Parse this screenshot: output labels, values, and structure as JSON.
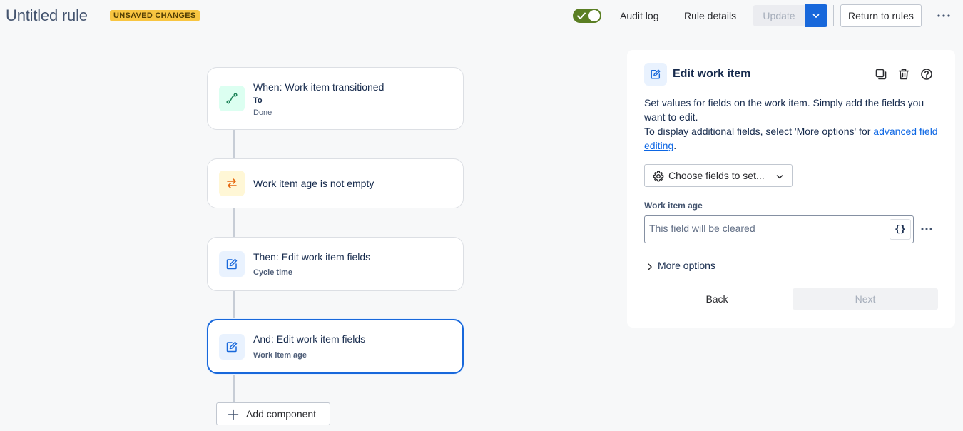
{
  "header": {
    "title": "Untitled rule",
    "badge": "UNSAVED CHANGES",
    "audit_log": "Audit log",
    "rule_details": "Rule details",
    "update": "Update",
    "return_to_rules": "Return to rules",
    "rule_enabled": true
  },
  "flow": {
    "trigger": {
      "title": "When: Work item transitioned",
      "sub": "To",
      "value": "Done"
    },
    "condition": {
      "title": "Work item age is not empty"
    },
    "action1": {
      "title": "Then: Edit work item fields",
      "sub": "Cycle time"
    },
    "action2": {
      "title": "And: Edit work item fields",
      "sub": "Work item age"
    },
    "add_component": "Add component"
  },
  "panel": {
    "title": "Edit work item",
    "desc_line1": "Set values for fields on the work item. Simply add the fields you want to edit.",
    "desc_line2_pre": "To display additional fields, select 'More options' for ",
    "desc_link": "advanced field editing",
    "desc_line2_post": ".",
    "choose_fields": "Choose fields to set...",
    "field_label": "Work item age",
    "field_placeholder": "This field will be cleared",
    "braces": "{}",
    "more_options": "More options",
    "back": "Back",
    "next": "Next"
  },
  "colors": {
    "accent": "#1868db",
    "toggle_on": "#5b7f24",
    "badge_bg": "#f8c541",
    "trigger_icon_bg": "#dcfff1",
    "condition_icon_bg": "#fff7d6",
    "action_icon_bg": "#e9f2fe"
  },
  "icons": {
    "trigger": "branch-flow-icon",
    "condition": "swap-arrows-icon",
    "action": "pencil-edit-icon",
    "panel_actions": [
      "copy-icon",
      "trash-icon",
      "help-icon"
    ]
  }
}
